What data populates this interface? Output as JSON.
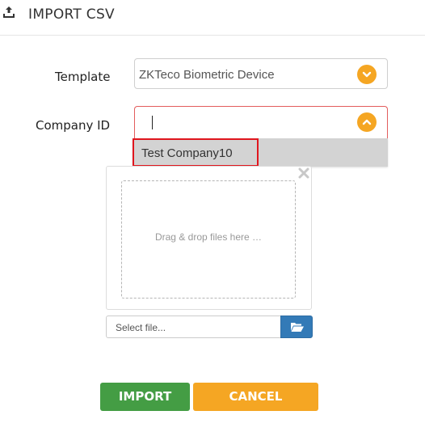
{
  "header": {
    "title": "IMPORT CSV",
    "icon": "upload-icon"
  },
  "form": {
    "template_label": "Template",
    "template_value": "ZKTeco Biometric Device",
    "company_label": "Company ID",
    "company_value": "",
    "company_options": [
      "Test Company10"
    ]
  },
  "dropzone": {
    "text": "Drag & drop files here …"
  },
  "file_input": {
    "placeholder": "Select file..."
  },
  "buttons": {
    "import": "IMPORT",
    "cancel": "CANCEL"
  },
  "colors": {
    "accent_orange": "#f5a623",
    "import_green": "#449d44",
    "browse_blue": "#337ab7",
    "highlight_red": "#e0161e"
  }
}
